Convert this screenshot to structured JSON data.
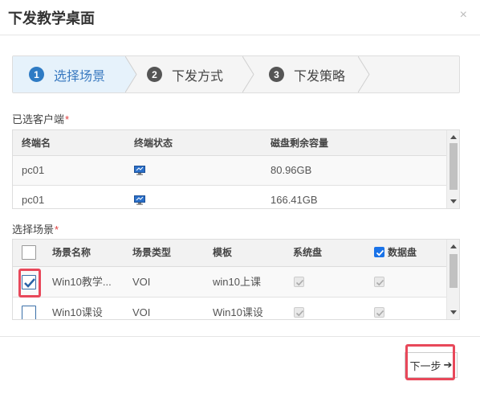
{
  "dialog": {
    "title": "下发教学桌面",
    "close": "×"
  },
  "steps": [
    {
      "num": "1",
      "label": "选择场景"
    },
    {
      "num": "2",
      "label": "下发方式"
    },
    {
      "num": "3",
      "label": "下发策略"
    }
  ],
  "clients": {
    "label": "已选客户端",
    "required": "*",
    "columns": [
      "终端名",
      "终端状态",
      "磁盘剩余容量"
    ],
    "rows": [
      {
        "name": "pc01",
        "status_icon": "monitor-online-icon",
        "disk": "80.96GB"
      },
      {
        "name": "pc01",
        "status_icon": "monitor-online-icon",
        "disk": "166.41GB"
      }
    ]
  },
  "scenes": {
    "label": "选择场景",
    "required": "*",
    "columns": [
      "场景名称",
      "场景类型",
      "模板",
      "系统盘",
      "数据盘"
    ],
    "rows": [
      {
        "selected": true,
        "name": "Win10教学...",
        "type": "VOI",
        "template": "win10上课",
        "system_disk": true,
        "data_disk": true
      },
      {
        "selected": false,
        "name": "Win10课设",
        "type": "VOI",
        "template": "Win10课设",
        "system_disk": true,
        "data_disk": true
      }
    ]
  },
  "footer": {
    "next_label": "下一步",
    "next_icon": "arrow-right-icon"
  },
  "colors": {
    "accent": "#2e7bc4",
    "highlight": "#e8485a",
    "required": "#e03c3c"
  }
}
